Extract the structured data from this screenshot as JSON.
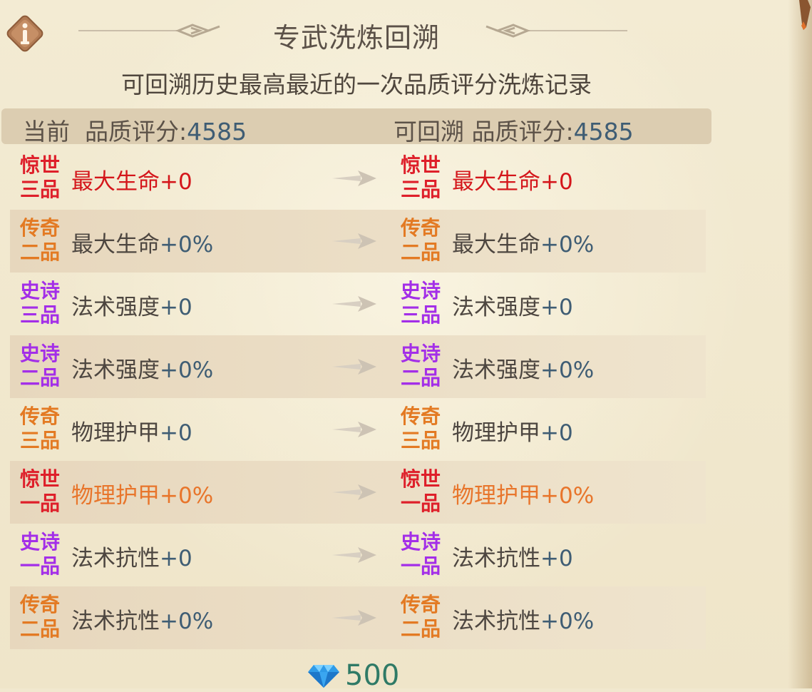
{
  "panel": {
    "title": "专武洗炼回溯",
    "subtitle": "可回溯历史最高最近的一次品质评分洗炼记录"
  },
  "header": {
    "current_label": "当前  品质评分:",
    "current_score": "4585",
    "rollback_label": "可回溯 品质评分:",
    "rollback_score": "4585"
  },
  "rows": [
    {
      "quality": "惊世",
      "tier": "三品",
      "quality_color": "#de1f2a",
      "stat": "最大生命",
      "value": "+0",
      "stat_color": "red",
      "shaded": false
    },
    {
      "quality": "传奇",
      "tier": "二品",
      "quality_color": "#e37a23",
      "stat": "最大生命",
      "value": "+0%",
      "stat_color": "normal",
      "shaded": true
    },
    {
      "quality": "史诗",
      "tier": "三品",
      "quality_color": "#a32ee8",
      "stat": "法术强度",
      "value": "+0",
      "stat_color": "normal",
      "shaded": false
    },
    {
      "quality": "史诗",
      "tier": "二品",
      "quality_color": "#a32ee8",
      "stat": "法术强度",
      "value": "+0%",
      "stat_color": "normal",
      "shaded": true
    },
    {
      "quality": "传奇",
      "tier": "三品",
      "quality_color": "#e37a23",
      "stat": "物理护甲",
      "value": "+0",
      "stat_color": "normal",
      "shaded": false
    },
    {
      "quality": "惊世",
      "tier": "一品",
      "quality_color": "#de1f2a",
      "stat": "物理护甲",
      "value": "+0%",
      "stat_color": "orange",
      "shaded": true
    },
    {
      "quality": "史诗",
      "tier": "一品",
      "quality_color": "#a32ee8",
      "stat": "法术抗性",
      "value": "+0",
      "stat_color": "normal",
      "shaded": false
    },
    {
      "quality": "传奇",
      "tier": "二品",
      "quality_color": "#e37a23",
      "stat": "法术抗性",
      "value": "+0%",
      "stat_color": "normal",
      "shaded": true
    }
  ],
  "cost": {
    "icon": "diamond-icon",
    "amount": "500"
  },
  "colors": {
    "background": "#f1e8cf",
    "header_bar": "#dccdb1",
    "value_blue": "#3f5d74",
    "cost_green": "#2f7a66"
  }
}
